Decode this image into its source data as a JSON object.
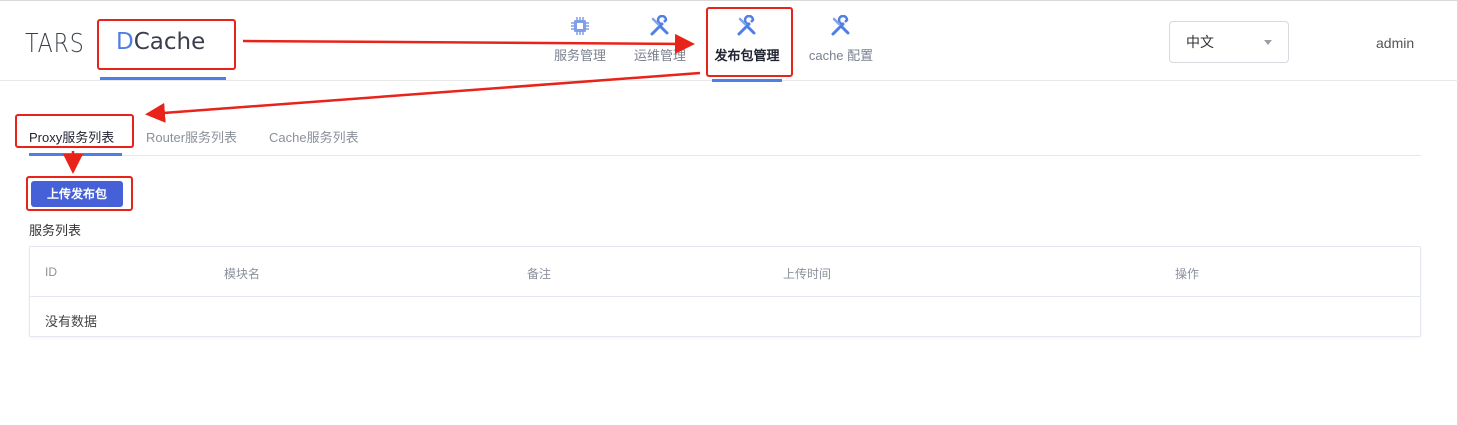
{
  "header": {
    "brand": "TARS",
    "app_prefix": "D",
    "app_rest": "Cache",
    "nav": [
      {
        "label": "服务管理",
        "icon": "chip-icon"
      },
      {
        "label": "运维管理",
        "icon": "wrench-icon"
      },
      {
        "label": "发布包管理",
        "icon": "wrench-icon",
        "active": true
      },
      {
        "label": "cache 配置",
        "icon": "wrench-icon"
      }
    ],
    "language": "中文",
    "user": "admin"
  },
  "tabs": [
    {
      "label": "Proxy服务列表",
      "active": true
    },
    {
      "label": "Router服务列表"
    },
    {
      "label": "Cache服务列表"
    }
  ],
  "upload_button": "上传发布包",
  "section_title": "服务列表",
  "table": {
    "columns": [
      "ID",
      "模块名",
      "备注",
      "上传时间",
      "操作"
    ],
    "empty_text": "没有数据"
  },
  "colors": {
    "accent": "#4f7fe5",
    "button": "#4660d8",
    "annotation": "#e8231a"
  }
}
